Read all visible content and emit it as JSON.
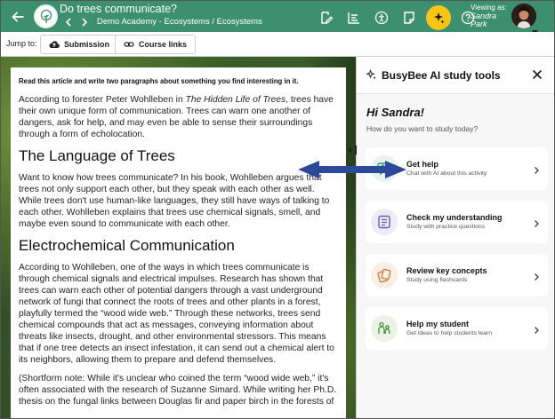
{
  "header": {
    "title": "Do trees communicate?",
    "breadcrumb": "Demo Academy - Ecosystems / Ecosystems",
    "viewing_label": "Viewing as:",
    "viewing_name_first": "Sandra",
    "viewing_name_last": "Park",
    "brand_color": "#3d8f72",
    "ai_button_color": "#f7c518"
  },
  "jumpbar": {
    "label": "Jump to:",
    "buttons": [
      {
        "label": "Submission",
        "icon": "cloud-upload-icon"
      },
      {
        "label": "Course links",
        "icon": "link-icon"
      }
    ]
  },
  "article": {
    "instruction": "Read this article and write two paragraphs about something you find interesting in it.",
    "intro_before": "According to forester Peter Wohlleben in ",
    "intro_book": "The Hidden Life of Trees",
    "intro_after": ", trees have their own unique form of communication. Trees can warn one another of dangers, ask for help, and may even be able to sense their surroundings through a form of echolocation.",
    "heading1": "The Language of Trees",
    "para1": "Want to know how trees communicate? In his book, Wohlleben argues that trees not only support each other, but they speak with each other as well. While trees don't use human-like languages, they still have ways of talking to each other. Wohlleben explains that trees use chemical signals, smell, and maybe even sound to communicate with each other.",
    "heading2": "Electrochemical Communication",
    "para2": "According to Wohlleben, one of the ways in which trees communicate is through chemical signals and electrical impulses. Research has shown that trees can warn each other of potential dangers through a vast underground network of fungi that connect the roots of trees and other plants in a forest, playfully termed the “wood wide web.” Through these networks, trees send chemical compounds that act as messages, conveying information about threats like insects, drought, and other environmental stressors. This means that if one tree detects an insect infestation, it can send out a chemical alert to its neighbors, allowing them to prepare and defend themselves.",
    "para3": "(Shortform note: While it's unclear who coined the term “wood wide web,” it's often associated with the research of Suzanne Simard. While writing her Ph.D. thesis on the fungal links between Douglas fir and paper birch in the forests of"
  },
  "panel": {
    "title": "BusyBee AI study tools",
    "greeting": "Hi Sandra!",
    "subtext": "How do you want to study today?",
    "cards": [
      {
        "title": "Get help",
        "subtitle": "Chat with AI about this activity",
        "icon": "chat-help-icon",
        "color": "#3d8f72",
        "bg": "#e7f3ee"
      },
      {
        "title": "Check my understanding",
        "subtitle": "Study with practice questions",
        "icon": "checklist-icon",
        "color": "#6b5bb5",
        "bg": "#eeeaf7"
      },
      {
        "title": "Review key concepts",
        "subtitle": "Study using flashcards",
        "icon": "flashcards-icon",
        "color": "#c7773a",
        "bg": "#fbeee3"
      },
      {
        "title": "Help my student",
        "subtitle": "Get ideas to help students learn",
        "icon": "parent-student-icon",
        "color": "#4c8f3a",
        "bg": "#e8f4e4"
      }
    ]
  }
}
